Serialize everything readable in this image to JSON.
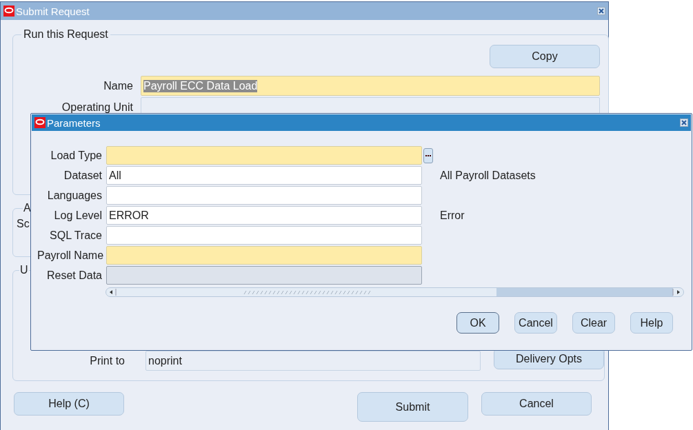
{
  "main_window": {
    "title": "Submit Request",
    "active": false,
    "run_group": {
      "title": "Run this Request",
      "copy_button": {
        "label": "Copy"
      },
      "fields": [
        {
          "label": "Name",
          "value": "Payroll ECC Data Load",
          "required": true,
          "highlighted": true
        },
        {
          "label": "Operating Unit",
          "required": false
        }
      ]
    },
    "group_2": {
      "title": "A",
      "label": "Sc"
    },
    "group_3": {
      "title": "U",
      "print_to": {
        "label": "Print to",
        "value": "noprint"
      },
      "delivery_button": {
        "label": "Delivery Opts"
      }
    },
    "buttons": [
      {
        "label": "Help (C)",
        "kind": "left"
      },
      {
        "label": "Submit",
        "kind": "tall"
      },
      {
        "label": "Cancel",
        "kind": "normal"
      }
    ]
  },
  "parameters_dialog": {
    "title": "Parameters",
    "active": true,
    "fields": [
      {
        "label": "Load Type",
        "required": true,
        "disabled": false,
        "lov": true
      },
      {
        "label": "Dataset",
        "value": "All",
        "description": "All Payroll Datasets",
        "required": false,
        "disabled": false
      },
      {
        "label": "Languages",
        "required": false,
        "disabled": false
      },
      {
        "label": "Log Level",
        "value": "ERROR",
        "description": "Error",
        "required": false,
        "disabled": false
      },
      {
        "label": "SQL Trace",
        "required": false,
        "disabled": false
      },
      {
        "label": "Payroll Name",
        "required": true,
        "disabled": false
      },
      {
        "label": "Reset Data",
        "disabled": true
      }
    ],
    "buttons": [
      {
        "label": "OK",
        "default": true
      },
      {
        "label": "Cancel",
        "default": false
      },
      {
        "label": "Clear",
        "default": false
      },
      {
        "label": "Help",
        "default": false
      }
    ]
  }
}
